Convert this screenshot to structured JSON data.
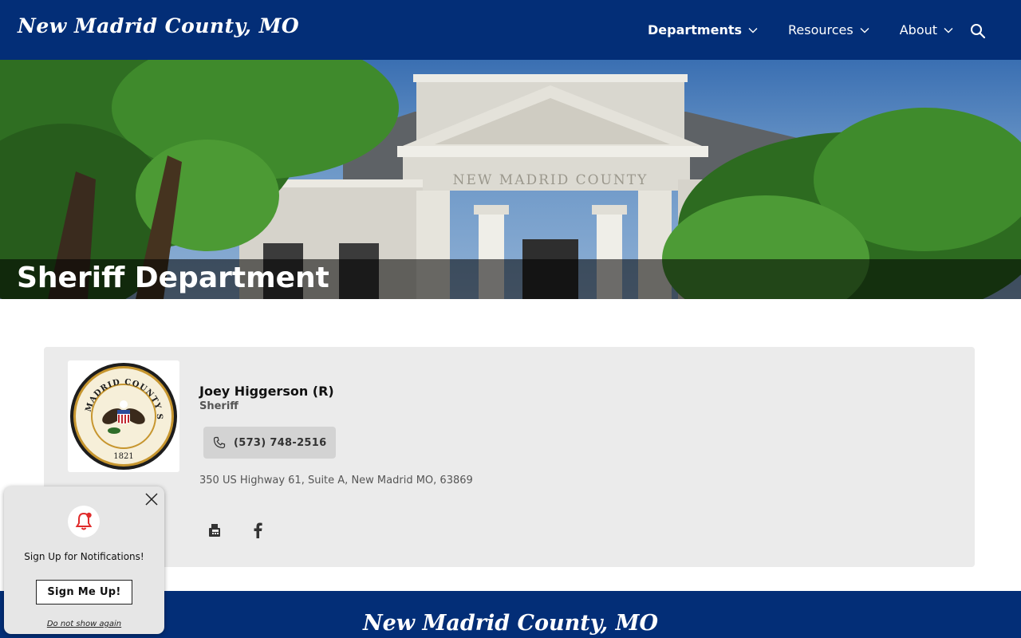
{
  "header": {
    "logo_text": "New Madrid County, MO",
    "nav": [
      {
        "label": "Departments",
        "active": true
      },
      {
        "label": "Resources",
        "active": false
      },
      {
        "label": "About",
        "active": false
      }
    ],
    "search_icon": "search-icon"
  },
  "hero": {
    "title": "Sheriff Department",
    "building_inscription": "NEW MADRID COUNTY"
  },
  "card": {
    "seal": {
      "ring_text": "NEW MADRID COUNTY SEAL",
      "year": "1821"
    },
    "name": "Joey Higgerson (R)",
    "title": "Sheriff",
    "phone": "(573) 748-2516",
    "address": "350 US Highway 61, Suite A, New Madrid MO, 63869",
    "icons": [
      "fax-icon",
      "facebook-icon"
    ]
  },
  "footer": {
    "logo_text": "New Madrid County, MO"
  },
  "popup": {
    "message": "Sign Up for Notifications!",
    "button_label": "Sign Me Up!",
    "dismiss_label": "Do not show again"
  },
  "colors": {
    "brand_blue": "#032e77",
    "card_bg": "#ebebeb",
    "alert_red": "#e02b2b"
  }
}
